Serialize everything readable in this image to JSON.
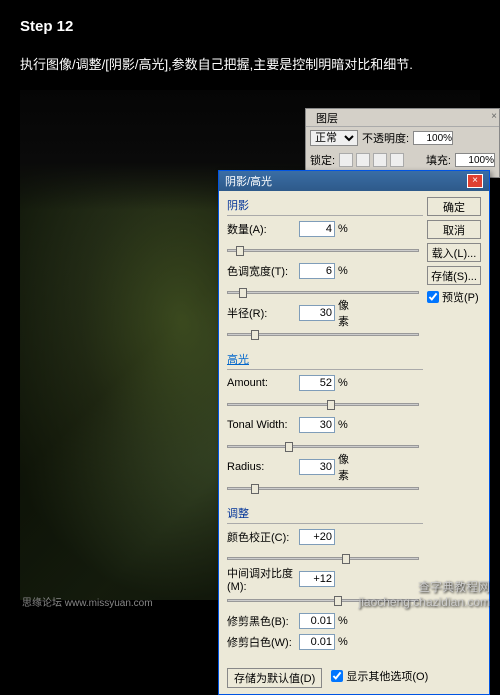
{
  "step": "Step 12",
  "instruction": "执行图像/调整/[阴影/高光],参数自己把握,主要是控制明暗对比和细节.",
  "layers_panel": {
    "tab": "图层",
    "blend_mode": "正常",
    "opacity_label": "不透明度:",
    "opacity_value": "100%",
    "lock_label": "锁定:",
    "fill_label": "填充:",
    "fill_value": "100%"
  },
  "dialog": {
    "title": "阴影/高光",
    "shadows_header": "阴影",
    "highlights_header": "高光",
    "adjustments_header": "调整",
    "fields": {
      "amount_a": {
        "label": "数量(A):",
        "value": "4",
        "unit": "%"
      },
      "tonal_t": {
        "label": "色调宽度(T):",
        "value": "6",
        "unit": "%"
      },
      "radius_r": {
        "label": "半径(R):",
        "value": "30",
        "unit": "像素"
      },
      "amount": {
        "label": "Amount:",
        "value": "52",
        "unit": "%"
      },
      "tonal_width": {
        "label": "Tonal Width:",
        "value": "30",
        "unit": "%"
      },
      "radius": {
        "label": "Radius:",
        "value": "30",
        "unit": "像素"
      },
      "color_c": {
        "label": "颜色校正(C):",
        "value": "+20",
        "unit": ""
      },
      "midtone_m": {
        "label": "中间调对比度(M):",
        "value": "+12",
        "unit": ""
      },
      "black_b": {
        "label": "修剪黑色(B):",
        "value": "0.01",
        "unit": "%"
      },
      "white_w": {
        "label": "修剪白色(W):",
        "value": "0.01",
        "unit": "%"
      }
    },
    "buttons": {
      "ok": "确定",
      "cancel": "取消",
      "load": "载入(L)...",
      "save": "存储(S)...",
      "preview": "预览(P)",
      "save_default": "存储为默认值(D)",
      "show_more": "显示其他选项(O)"
    }
  },
  "watermarks": {
    "left": "思缘论坛  www.missyuan.com",
    "right": "查字典教程网\njiaocheng.chazidian.com"
  }
}
